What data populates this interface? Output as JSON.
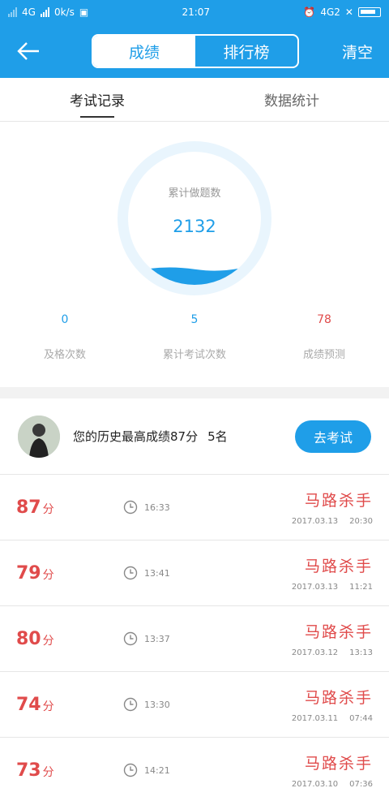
{
  "status_bar": {
    "network_left": "4G",
    "speed": "0k/s",
    "time": "21:07",
    "network_right": "4G2"
  },
  "header": {
    "segments": [
      "成绩",
      "排行榜"
    ],
    "active_segment": 0,
    "clear_label": "清空"
  },
  "tabs": [
    {
      "label": "考试记录",
      "active": true
    },
    {
      "label": "数据统计",
      "active": false
    }
  ],
  "gauge": {
    "label": "累计做题数",
    "value": "2132",
    "fill_fraction": 0.42,
    "color": "#1f9ee8"
  },
  "stats": [
    {
      "value": "0",
      "label": "及格次数",
      "color": "#1f9ee8"
    },
    {
      "value": "5",
      "label": "累计考试次数",
      "color": "#1f9ee8"
    },
    {
      "value": "78",
      "label": "成绩预测",
      "color": "#e04b4b"
    }
  ],
  "best": {
    "text": "您的历史最高成绩87分",
    "rank": "5名",
    "button_label": "去考试"
  },
  "records": [
    {
      "score": "87",
      "unit": "分",
      "duration": "16:33",
      "title": "马路杀手",
      "date": "2017.03.13",
      "time": "20:30"
    },
    {
      "score": "79",
      "unit": "分",
      "duration": "13:41",
      "title": "马路杀手",
      "date": "2017.03.13",
      "time": "11:21"
    },
    {
      "score": "80",
      "unit": "分",
      "duration": "13:37",
      "title": "马路杀手",
      "date": "2017.03.12",
      "time": "13:13"
    },
    {
      "score": "74",
      "unit": "分",
      "duration": "13:30",
      "title": "马路杀手",
      "date": "2017.03.11",
      "time": "07:44"
    },
    {
      "score": "73",
      "unit": "分",
      "duration": "14:21",
      "title": "马路杀手",
      "date": "2017.03.10",
      "time": "07:36"
    }
  ]
}
